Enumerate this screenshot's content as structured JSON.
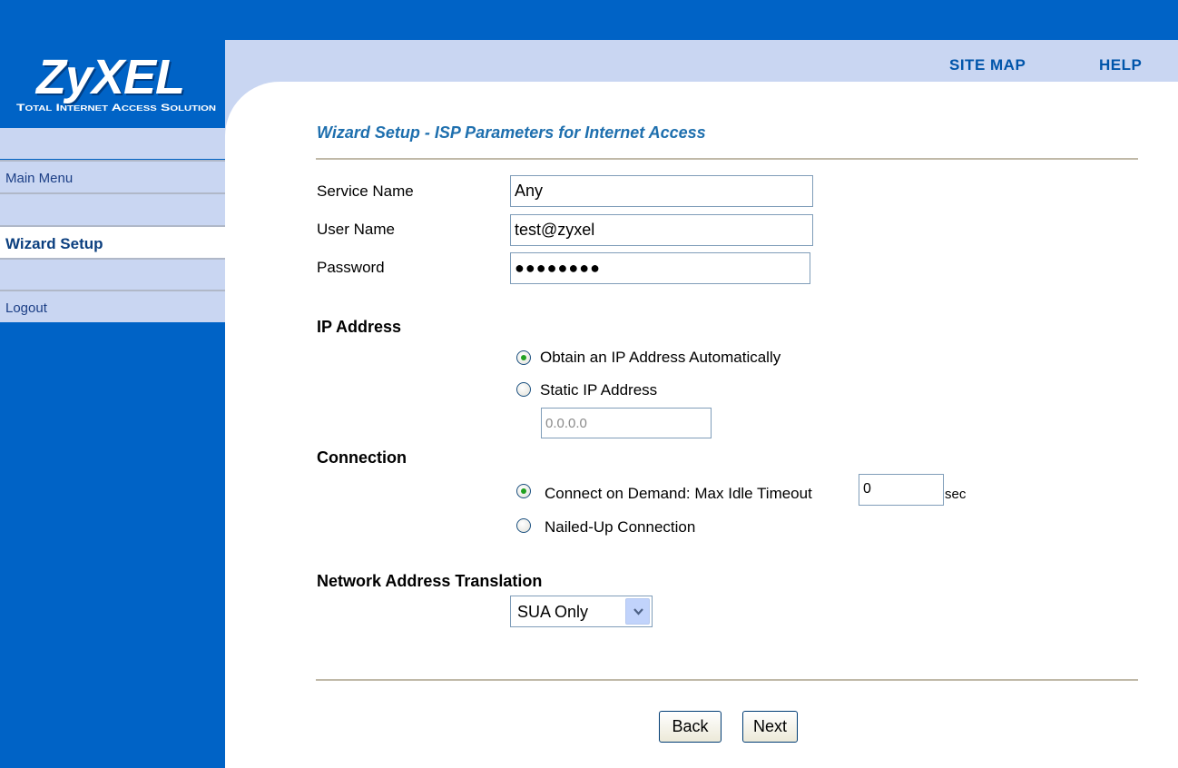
{
  "brand": {
    "logo_text": "ZyXEL",
    "tagline": "Total Internet Access Solution"
  },
  "header": {
    "site_map": "SITE MAP",
    "help": "HELP"
  },
  "sidebar": {
    "items": [
      {
        "label": "Main Menu",
        "active": false
      },
      {
        "label": "Wizard Setup",
        "active": true
      },
      {
        "label": "Logout",
        "active": false
      }
    ]
  },
  "page": {
    "title": "Wizard Setup - ISP Parameters for Internet Access"
  },
  "form": {
    "service_name": {
      "label": "Service Name",
      "value": "Any"
    },
    "user_name": {
      "label": "User Name",
      "value": "test@zyxel"
    },
    "password": {
      "label": "Password",
      "value": "●●●●●●●●"
    },
    "ip_address": {
      "heading": "IP Address",
      "auto_label": "Obtain an IP Address Automatically",
      "static_label": "Static IP Address",
      "selected": "auto",
      "static_value": "0.0.0.0"
    },
    "connection": {
      "heading": "Connection",
      "demand_label": "Connect on Demand: Max Idle Timeout",
      "idle_timeout": "0",
      "unit": "sec",
      "nailed_label": "Nailed-Up Connection",
      "selected": "demand"
    },
    "nat": {
      "heading": "Network Address Translation",
      "selected": "SUA Only"
    }
  },
  "buttons": {
    "back": "Back",
    "next": "Next"
  },
  "colors": {
    "brand_blue": "#0063c6",
    "menu_background": "#c9d6f2",
    "title_color": "#1e6fae",
    "radio_dot": "#21a121"
  }
}
